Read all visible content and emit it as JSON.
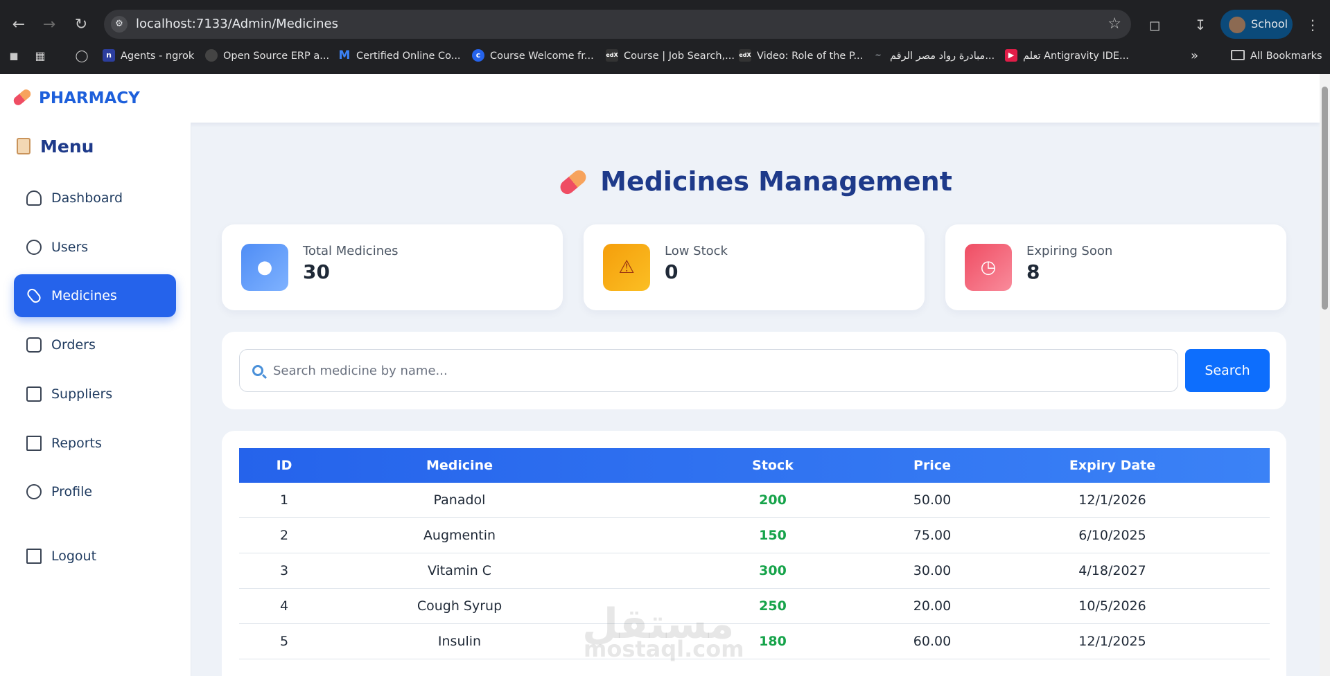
{
  "browser": {
    "url": "localhost:7133/Admin/Medicines",
    "profile_name": "School",
    "bookmarks": [
      {
        "label": "Agents - ngrok",
        "icon": "ngrok-icon",
        "color": "#2c3e9e"
      },
      {
        "label": "Open Source ERP a...",
        "icon": "erp-icon",
        "color": "#444444"
      },
      {
        "label": "Certified Online Co...",
        "icon": "m-logo-icon",
        "color": "#3b82f6"
      },
      {
        "label": "Course Welcome fr...",
        "icon": "c-logo-icon",
        "color": "#2563eb"
      },
      {
        "label": "Course | Job Search,...",
        "icon": "edx-icon",
        "color": "#333333"
      },
      {
        "label": "Video: Role of the P...",
        "icon": "edx-icon",
        "color": "#333333"
      },
      {
        "label": "مبادرة رواد مصر الرقم...",
        "icon": "wave-icon",
        "color": "#555555"
      },
      {
        "label": "تعلم Antigravity IDE...",
        "icon": "youtube-icon",
        "color": "#e11d48"
      }
    ],
    "all_bookmarks_label": "All Bookmarks"
  },
  "app": {
    "brand": "PHARMACY"
  },
  "sidebar": {
    "title": "Menu",
    "items": [
      {
        "label": "Dashboard",
        "icon": "gauge-icon",
        "active": false
      },
      {
        "label": "Users",
        "icon": "users-icon",
        "active": false
      },
      {
        "label": "Medicines",
        "icon": "capsule-icon",
        "active": true
      },
      {
        "label": "Orders",
        "icon": "bag-check-icon",
        "active": false
      },
      {
        "label": "Suppliers",
        "icon": "truck-icon",
        "active": false
      },
      {
        "label": "Reports",
        "icon": "bar-chart-icon",
        "active": false
      },
      {
        "label": "Profile",
        "icon": "user-circle-icon",
        "active": false
      }
    ],
    "logout_label": "Logout"
  },
  "main": {
    "title": "Medicines Management",
    "stats": [
      {
        "label": "Total Medicines",
        "value": "30",
        "icon": "pill-icon",
        "color": "#5b8def"
      },
      {
        "label": "Low Stock",
        "value": "0",
        "icon": "warning-icon",
        "color": "#f5a623"
      },
      {
        "label": "Expiring Soon",
        "value": "8",
        "icon": "alarm-clock-icon",
        "color": "#ef5a6f"
      }
    ],
    "search": {
      "placeholder": "Search medicine by name...",
      "button_label": "Search"
    },
    "table": {
      "columns": [
        "ID",
        "Medicine",
        "Stock",
        "Price",
        "Expiry Date"
      ],
      "rows": [
        [
          "1",
          "Panadol",
          "200",
          "50.00",
          "12/1/2026"
        ],
        [
          "2",
          "Augmentin",
          "150",
          "75.00",
          "6/10/2025"
        ],
        [
          "3",
          "Vitamin C",
          "300",
          "30.00",
          "4/18/2027"
        ],
        [
          "4",
          "Cough Syrup",
          "250",
          "20.00",
          "10/5/2026"
        ],
        [
          "5",
          "Insulin",
          "180",
          "60.00",
          "12/1/2025"
        ]
      ]
    },
    "watermark": {
      "arabic": "مستقل",
      "latin": "mostaql.com"
    }
  }
}
